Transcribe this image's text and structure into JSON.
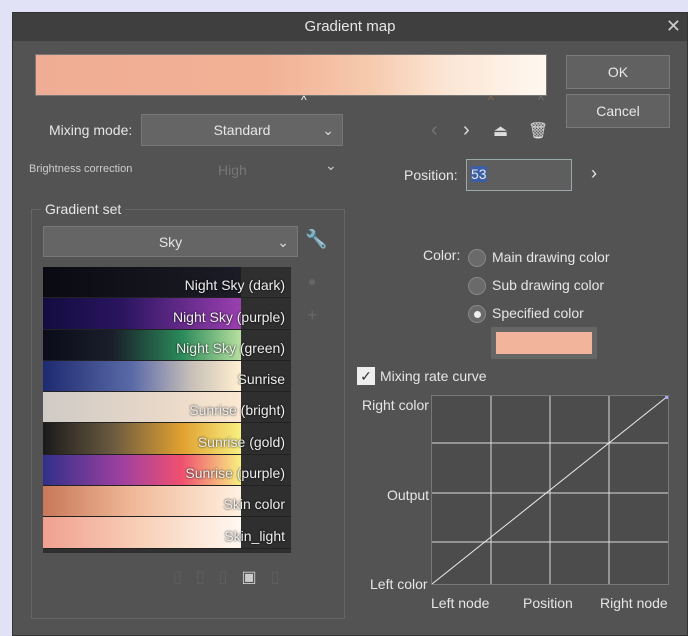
{
  "title": "Gradient map",
  "buttons": {
    "ok": "OK",
    "cancel": "Cancel"
  },
  "mixing_mode": {
    "label": "Mixing mode:",
    "value": "Standard"
  },
  "brightness": {
    "label": "Brightness correction",
    "value": "High"
  },
  "gradient_set": {
    "label": "Gradient set",
    "value": "Sky",
    "items": [
      {
        "label": "Night Sky (dark)",
        "gradient": "linear-gradient(90deg,#0a0a12,#1c1c26)"
      },
      {
        "label": "Night Sky (purple)",
        "gradient": "linear-gradient(90deg,#120c40,#2a1560 40%,#9b3fb0)"
      },
      {
        "label": "Night Sky (green)",
        "gradient": "linear-gradient(90deg,#0b0b1a,#1a1e2a 35%,#2a8a5a 70%,#b8e0a0)"
      },
      {
        "label": "Sunrise",
        "gradient": "linear-gradient(90deg,#1e2a70,#5a6aa8 45%,#c8c0b8 75%,#fff0d0)"
      },
      {
        "label": "Sunrise (bright)",
        "gradient": "linear-gradient(90deg,#cfcbc6,#e8d8c8 60%,#fbe8d2)"
      },
      {
        "label": "Sunrise (gold)",
        "gradient": "linear-gradient(90deg,#1a1a1a,#6a5a40 35%,#e0a030 70%,#f8f080)"
      },
      {
        "label": "Sunrise (purple)",
        "gradient": "linear-gradient(90deg,#30308a,#a040a0 40%,#f05070 70%,#f8f080)"
      },
      {
        "label": "Skin color",
        "gradient": "linear-gradient(90deg,#c87858,#f0b898 45%,#fff0e0)"
      },
      {
        "label": "Skin_light",
        "gradient": "linear-gradient(90deg,#f0a090,#f8d0b8 50%,#fff8f0)"
      }
    ]
  },
  "position": {
    "label": "Position:",
    "value": "53"
  },
  "color": {
    "label": "Color:",
    "options": [
      "Main drawing color",
      "Sub drawing color",
      "Specified color"
    ],
    "selected": 2,
    "swatch": "#f2b59c"
  },
  "mixing_rate_curve": {
    "label": "Mixing rate curve",
    "checked": true
  },
  "graph": {
    "right_color": "Right color",
    "output": "Output",
    "left_color": "Left color",
    "left_node": "Left node",
    "position": "Position",
    "right_node": "Right node"
  }
}
